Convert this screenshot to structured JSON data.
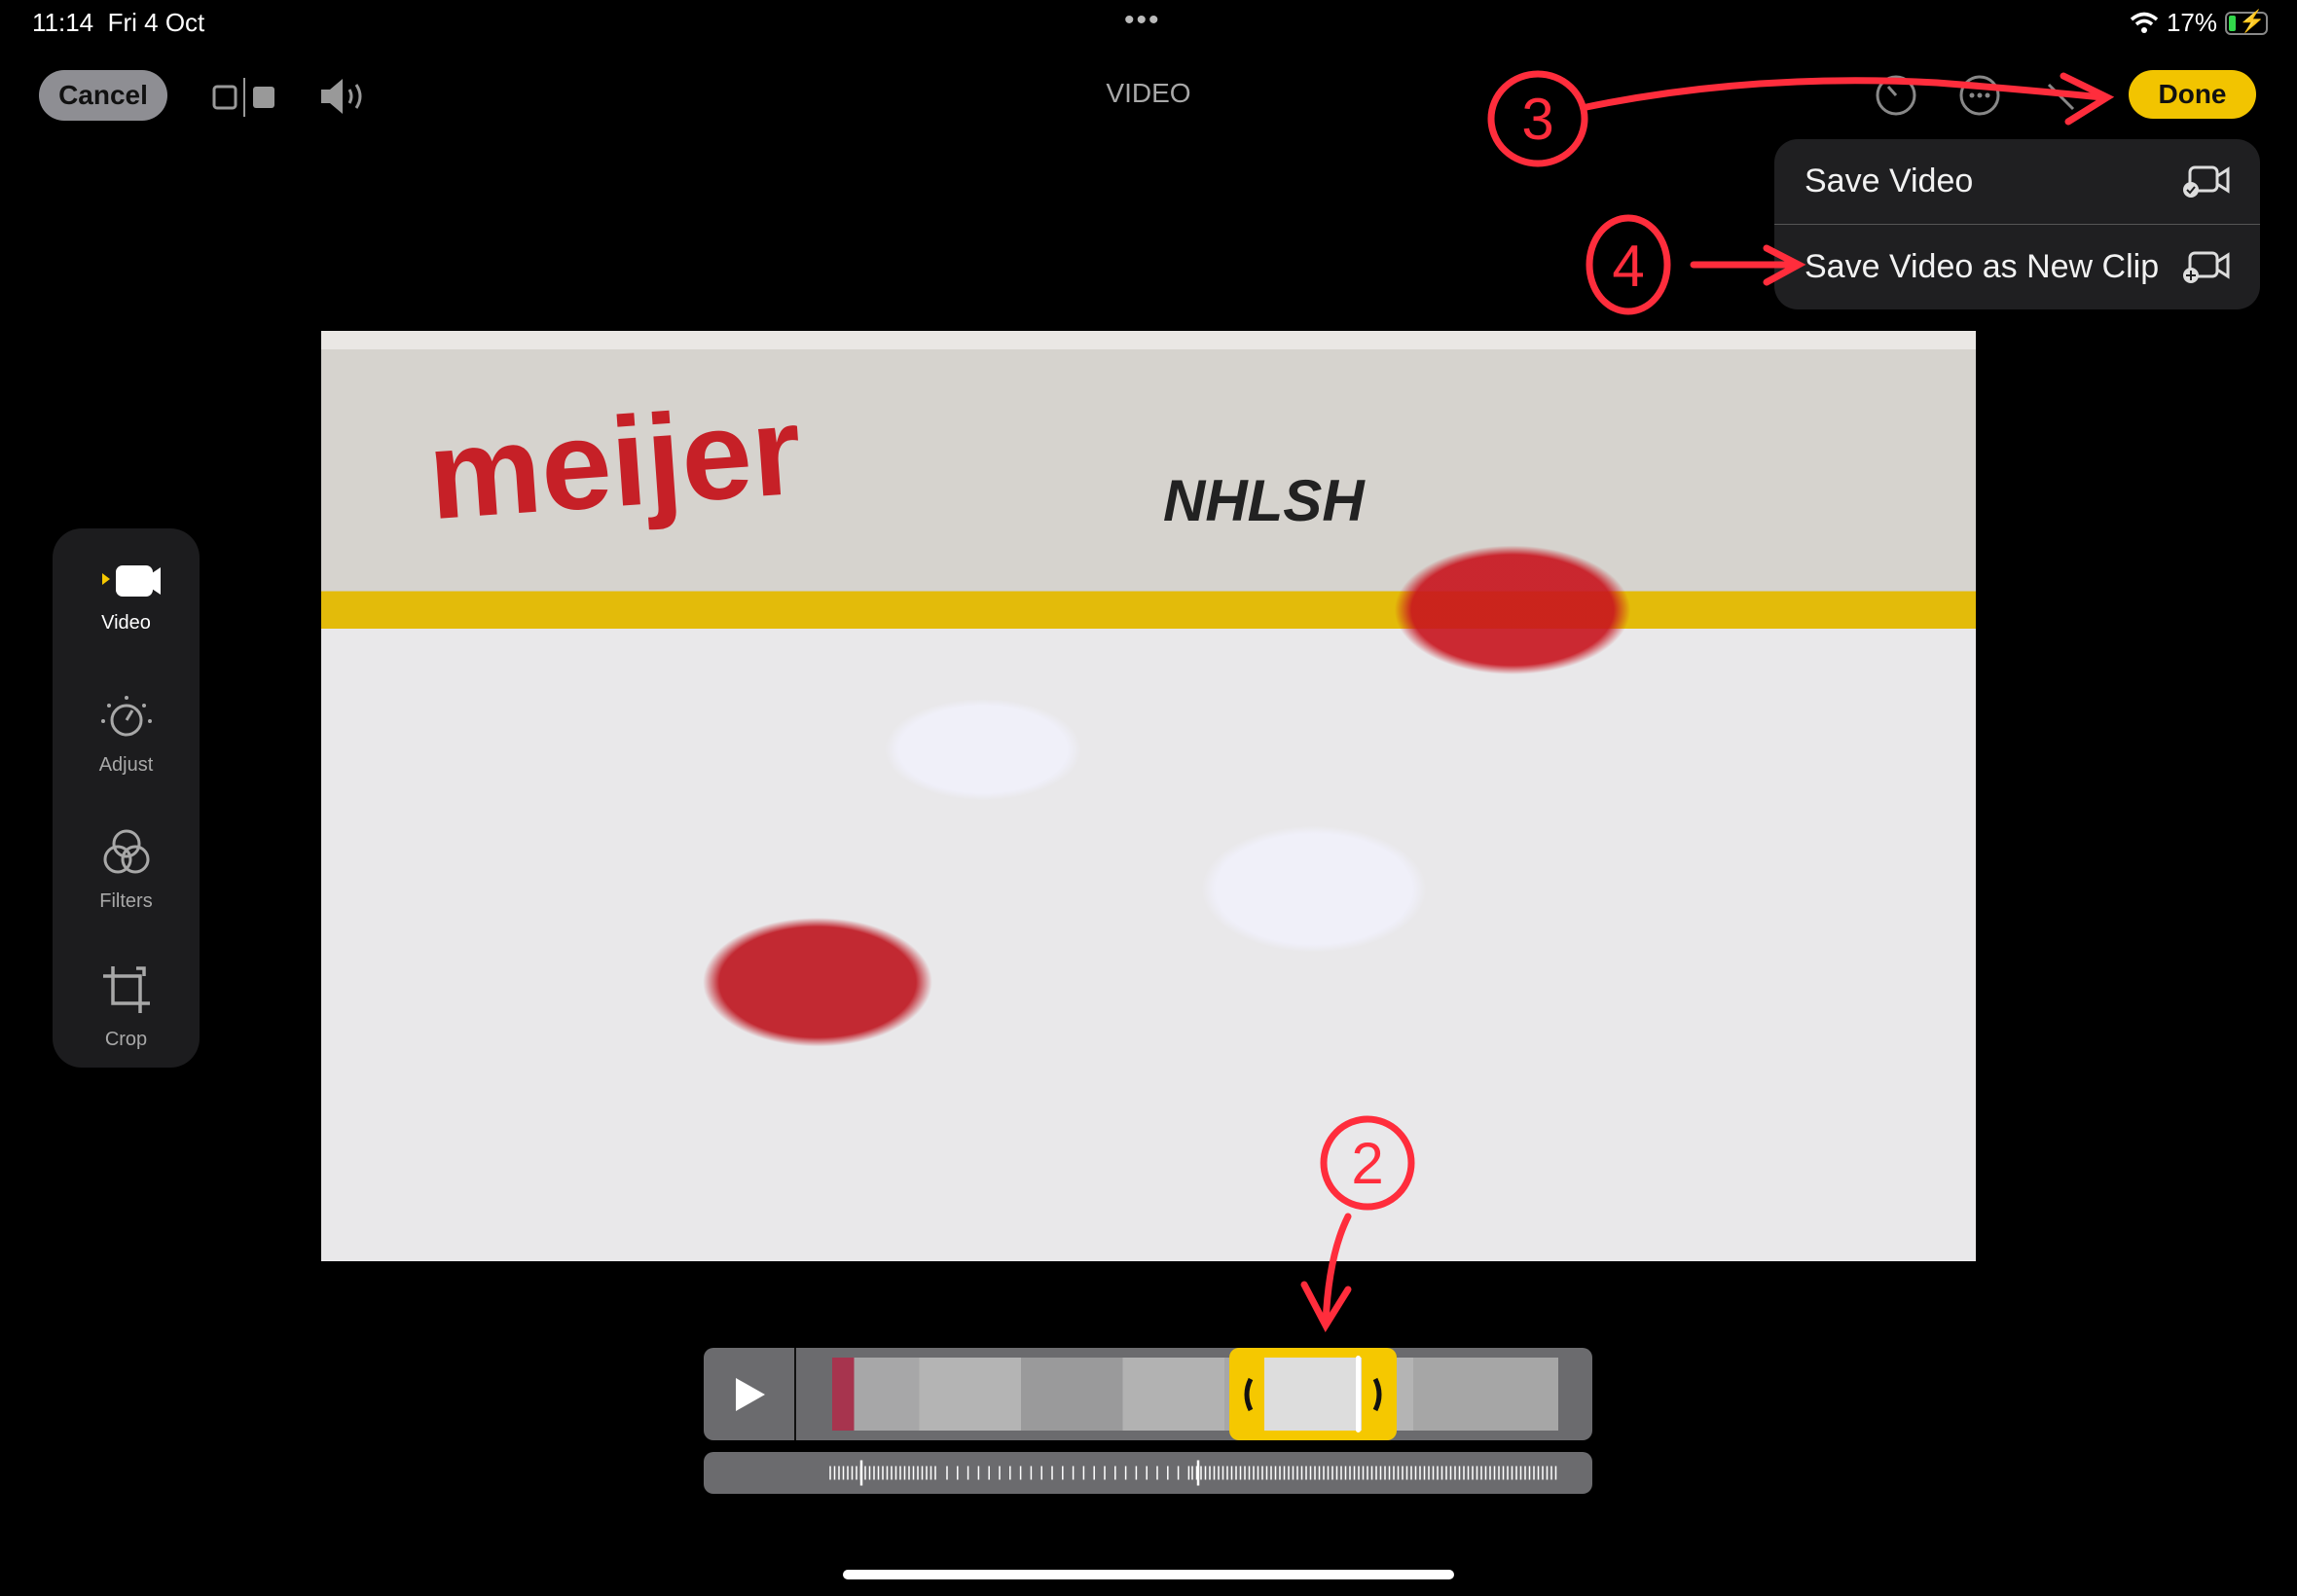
{
  "status_bar": {
    "time": "11:14",
    "date": "Fri 4 Oct",
    "battery": "17%",
    "battery_level": 0.17,
    "multitask_dots": "•••"
  },
  "toolbar": {
    "cancel_label": "Cancel",
    "title": "VIDEO",
    "done_label": "Done",
    "icons": [
      "compare-icon",
      "speaker-icon",
      "speed-icon",
      "more-icon",
      "markup-icon"
    ]
  },
  "menu": {
    "items": [
      {
        "label": "Save Video",
        "icon": "video-check-icon"
      },
      {
        "label": "Save Video as New Clip",
        "icon": "video-plus-icon"
      }
    ]
  },
  "video": {
    "board_text": "meijer",
    "board_text2": "NHLSH"
  },
  "sidebar": {
    "items": [
      {
        "label": "Video",
        "icon": "video-camera-icon",
        "selected": true
      },
      {
        "label": "Adjust",
        "icon": "adjust-dial-icon"
      },
      {
        "label": "Filters",
        "icon": "filters-icon"
      },
      {
        "label": "Crop",
        "icon": "crop-icon"
      }
    ]
  },
  "annotations": {
    "steps": [
      "2",
      "3",
      "4"
    ],
    "color": "#ff2d3c"
  },
  "colors": {
    "accent": "#f5c800",
    "menu_bg": "#1f1f21"
  }
}
